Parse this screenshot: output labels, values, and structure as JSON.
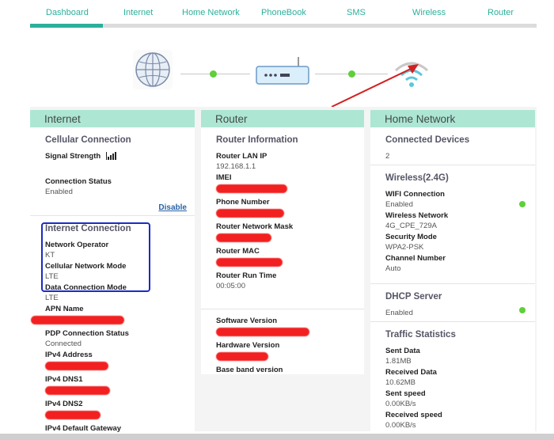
{
  "nav": {
    "items": [
      "Dashboard",
      "Internet",
      "Home Network",
      "PhoneBook",
      "SMS",
      "Wireless",
      "Router"
    ]
  },
  "colors": {
    "accent": "#2bb09a",
    "header": "#aee6d4",
    "status_ok": "#5fcf3a",
    "redact": "#f22020",
    "annot_box": "#1a2cc4",
    "annot_arrow": "#d22020"
  },
  "icons": [
    "globe-icon",
    "router-icon",
    "wifi-icon",
    "signal-icon"
  ],
  "internet": {
    "title": "Internet",
    "cellular": {
      "title": "Cellular Connection",
      "signal_label": "Signal Strength",
      "status_label": "Connection Status",
      "status_value": "Enabled",
      "disable_link": "Disable"
    },
    "connection": {
      "title": "Internet Connection",
      "operator_label": "Network Operator",
      "operator_value": "KT",
      "mode_label": "Cellular Network Mode",
      "mode_value": "LTE",
      "data_mode_label": "Data Connection Mode",
      "data_mode_value": "LTE",
      "apn_label": "APN Name",
      "pdp_label": "PDP Connection Status",
      "pdp_value": "Connected",
      "ipv4_label": "IPv4 Address",
      "dns1_label": "IPv4 DNS1",
      "dns2_label": "IPv4 DNS2",
      "gateway_label": "IPv4 Default Gateway"
    }
  },
  "router": {
    "title": "Router",
    "info": {
      "title": "Router Information",
      "lan_ip_label": "Router LAN IP",
      "lan_ip_value": "192.168.1.1",
      "imei_label": "IMEI",
      "phone_label": "Phone Number",
      "mask_label": "Router Network Mask",
      "mac_label": "Router MAC",
      "runtime_label": "Router Run Time",
      "runtime_value": "00:05:00"
    },
    "versions": {
      "software_label": "Software Version",
      "hardware_label": "Hardware Version",
      "baseband_label": "Base band version"
    }
  },
  "home": {
    "title": "Home Network",
    "devices": {
      "title": "Connected Devices",
      "value": "2"
    },
    "wireless": {
      "title": "Wireless(2.4G)",
      "wifi_label": "WIFI Connection",
      "wifi_value": "Enabled",
      "network_label": "Wireless Network",
      "network_value": "4G_CPE_729A",
      "security_label": "Security Mode",
      "security_value": "WPA2-PSK",
      "channel_label": "Channel Number",
      "channel_value": "Auto"
    },
    "dhcp": {
      "title": "DHCP Server",
      "value": "Enabled"
    },
    "traffic": {
      "title": "Traffic Statistics",
      "sent_label": "Sent Data",
      "sent_value": "1.81MB",
      "received_label": "Received Data",
      "received_value": "10.62MB",
      "sent_speed_label": "Sent speed",
      "sent_speed_value": "0.00KB/s",
      "received_speed_label": "Received speed",
      "received_speed_value": "0.00KB/s"
    }
  }
}
